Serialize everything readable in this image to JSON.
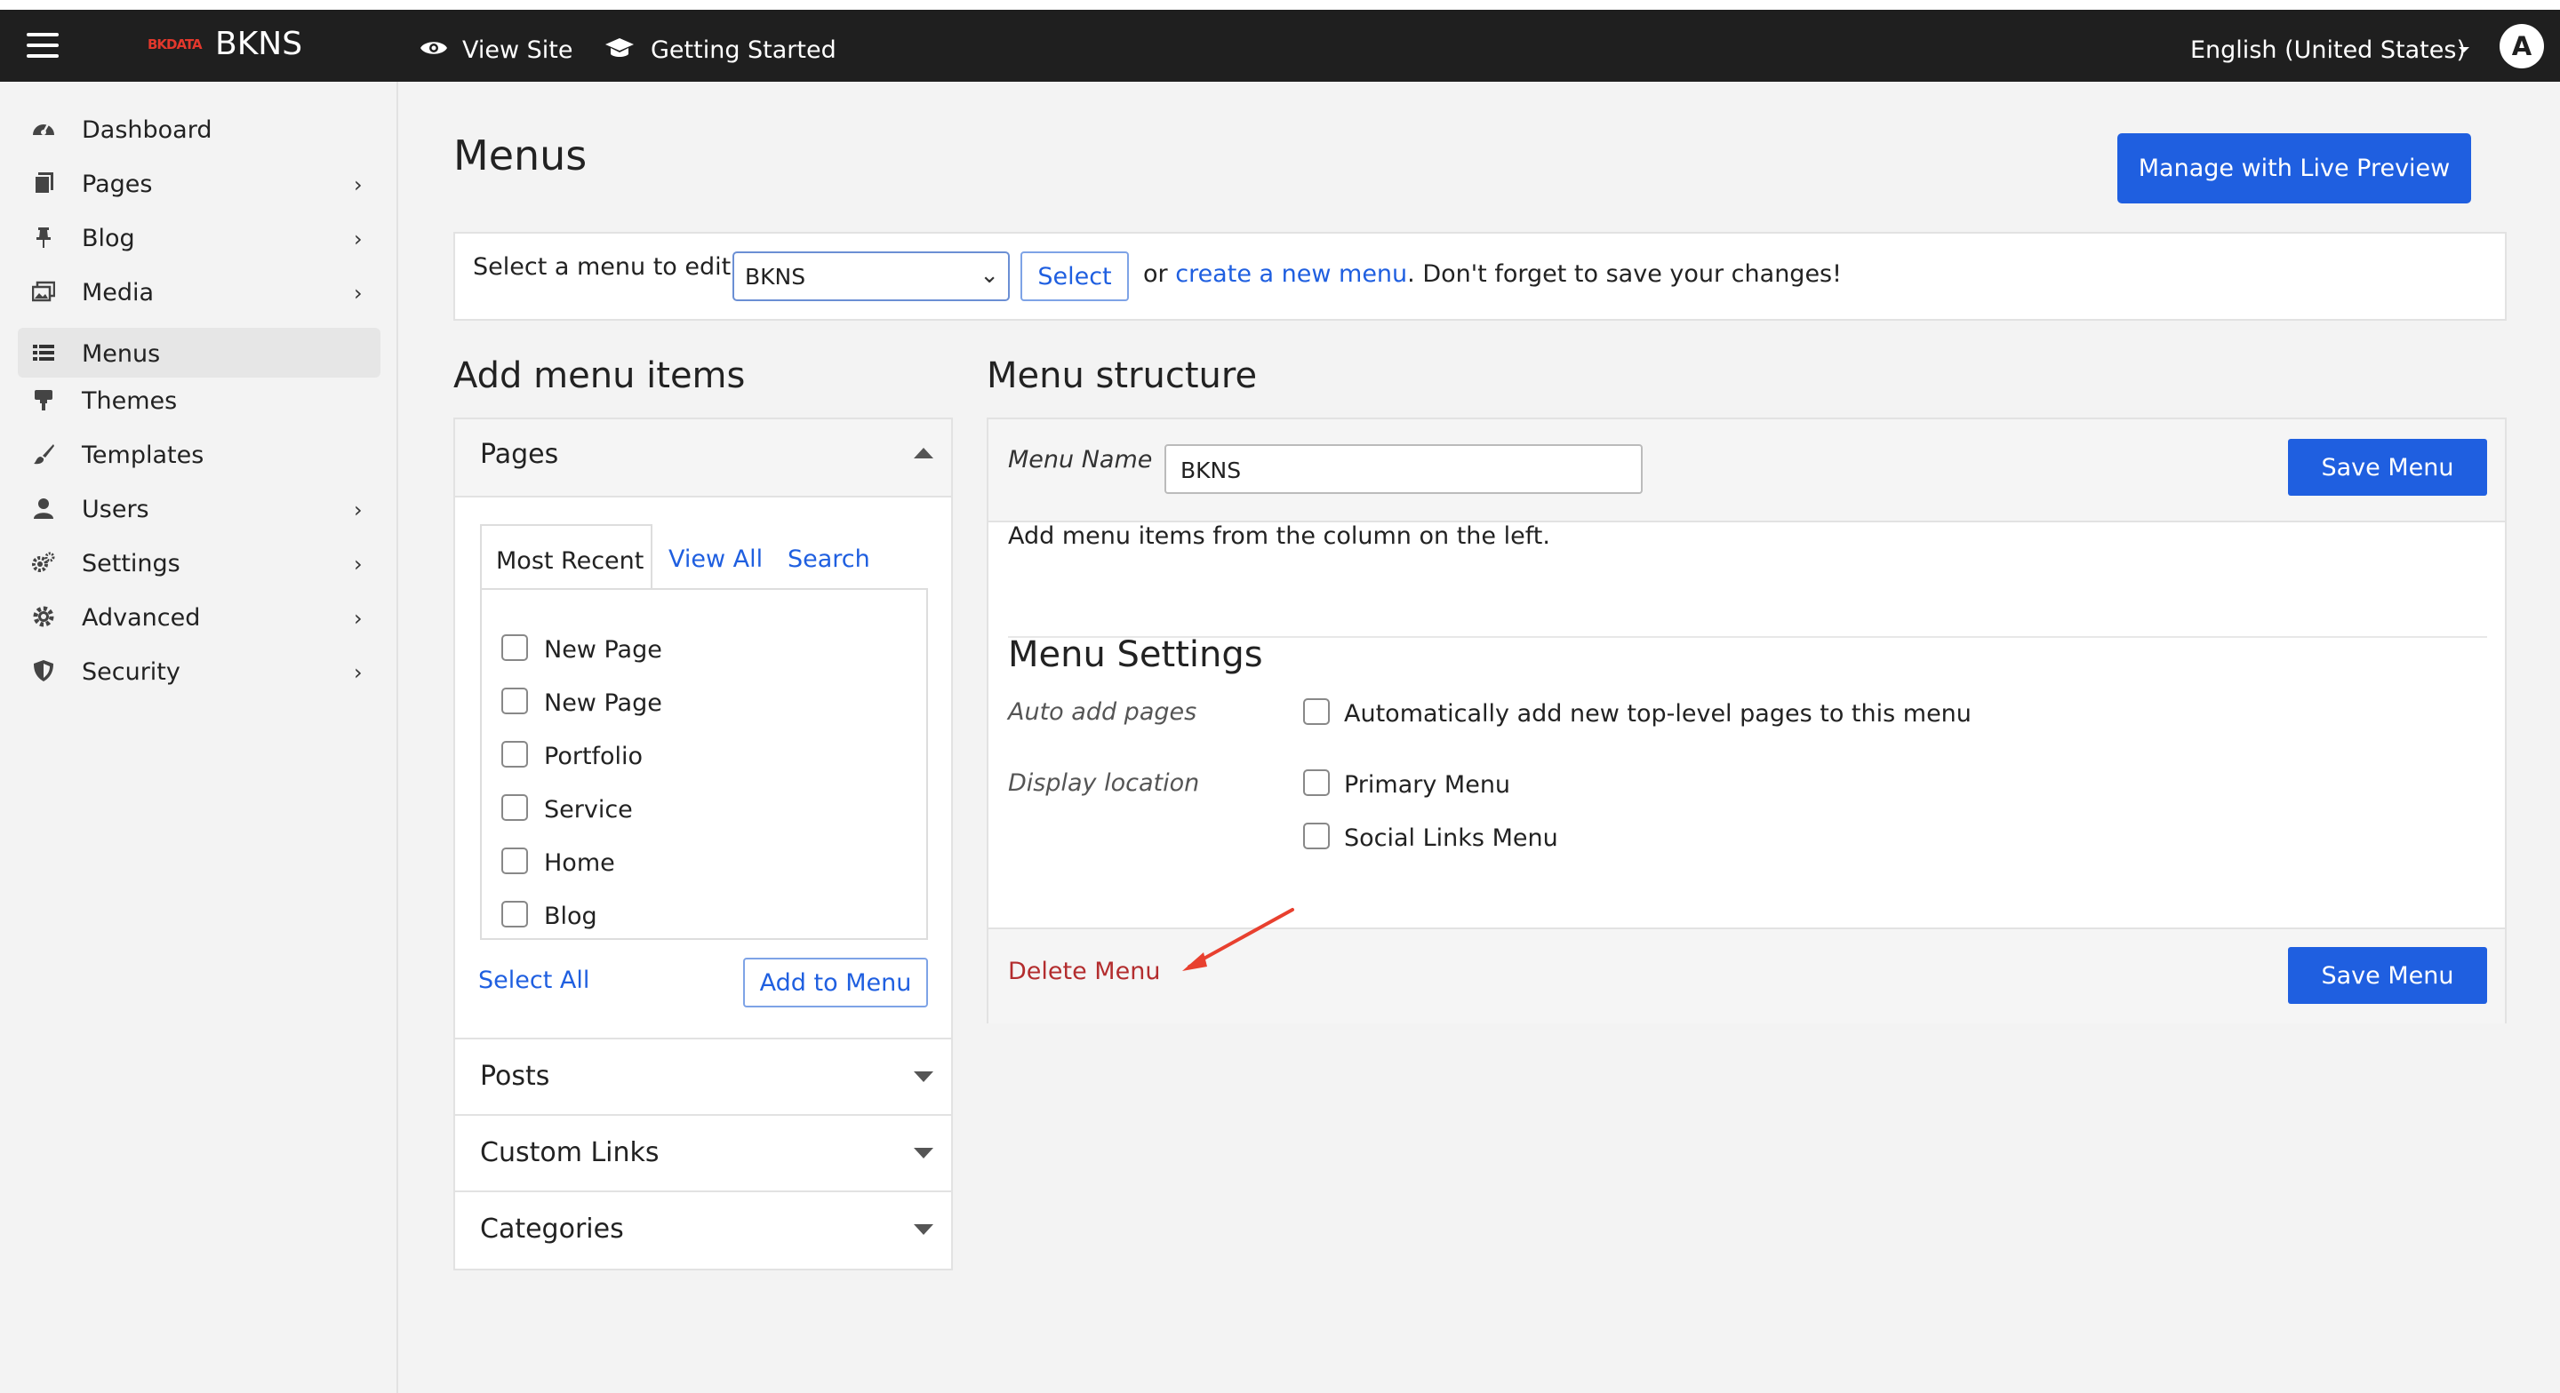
{
  "topbar": {
    "brand": "BKNS",
    "logo_text": "BKDATA",
    "view_site": "View Site",
    "getting_started": "Getting Started",
    "language": "English (United States)",
    "avatar": "A"
  },
  "sidebar": {
    "items": [
      {
        "label": "Dashboard",
        "icon": "dashboard-icon"
      },
      {
        "label": "Pages",
        "icon": "pages-icon"
      },
      {
        "label": "Blog",
        "icon": "pin-icon"
      },
      {
        "label": "Media",
        "icon": "media-icon"
      },
      {
        "label": "Menus",
        "icon": "list-icon"
      },
      {
        "label": "Themes",
        "icon": "paint-roller-icon"
      },
      {
        "label": "Templates",
        "icon": "brush-icon"
      },
      {
        "label": "Users",
        "icon": "user-icon"
      },
      {
        "label": "Settings",
        "icon": "gears-icon"
      },
      {
        "label": "Advanced",
        "icon": "gear-icon"
      },
      {
        "label": "Security",
        "icon": "shield-icon"
      }
    ]
  },
  "page": {
    "title": "Menus",
    "live_preview_button": "Manage with Live Preview"
  },
  "select_bar": {
    "label": "Select a menu to edit:",
    "selected_menu": "BKNS",
    "select_button": "Select",
    "or_text": "or",
    "create_link": "create a new menu",
    "tail_text": ". Don't forget to save your changes!"
  },
  "add_items": {
    "heading": "Add menu items",
    "pages_panel": {
      "title": "Pages",
      "tabs": [
        "Most Recent",
        "View All",
        "Search"
      ],
      "items": [
        "New Page",
        "New Page",
        "Portfolio",
        "Service",
        "Home",
        "Blog"
      ],
      "select_all": "Select All",
      "add_button": "Add to Menu"
    },
    "collapsed_panels": [
      "Posts",
      "Custom Links",
      "Categories"
    ]
  },
  "structure": {
    "heading": "Menu structure",
    "menu_name_label": "Menu Name",
    "menu_name_value": "BKNS",
    "save_button": "Save Menu",
    "instructions": "Add menu items from the column on the left.",
    "settings_heading": "Menu Settings",
    "auto_add_label": "Auto add pages",
    "auto_add_option": "Automatically add new top-level pages to this menu",
    "display_location_label": "Display location",
    "locations": [
      "Primary Menu",
      "Social Links Menu"
    ],
    "delete_link": "Delete Menu",
    "save_button_bottom": "Save Menu"
  },
  "colors": {
    "primary": "#1f5fe0",
    "topbar": "#1f1f1f",
    "delete": "#b32d2e",
    "annotation_arrow": "#e8402f"
  }
}
